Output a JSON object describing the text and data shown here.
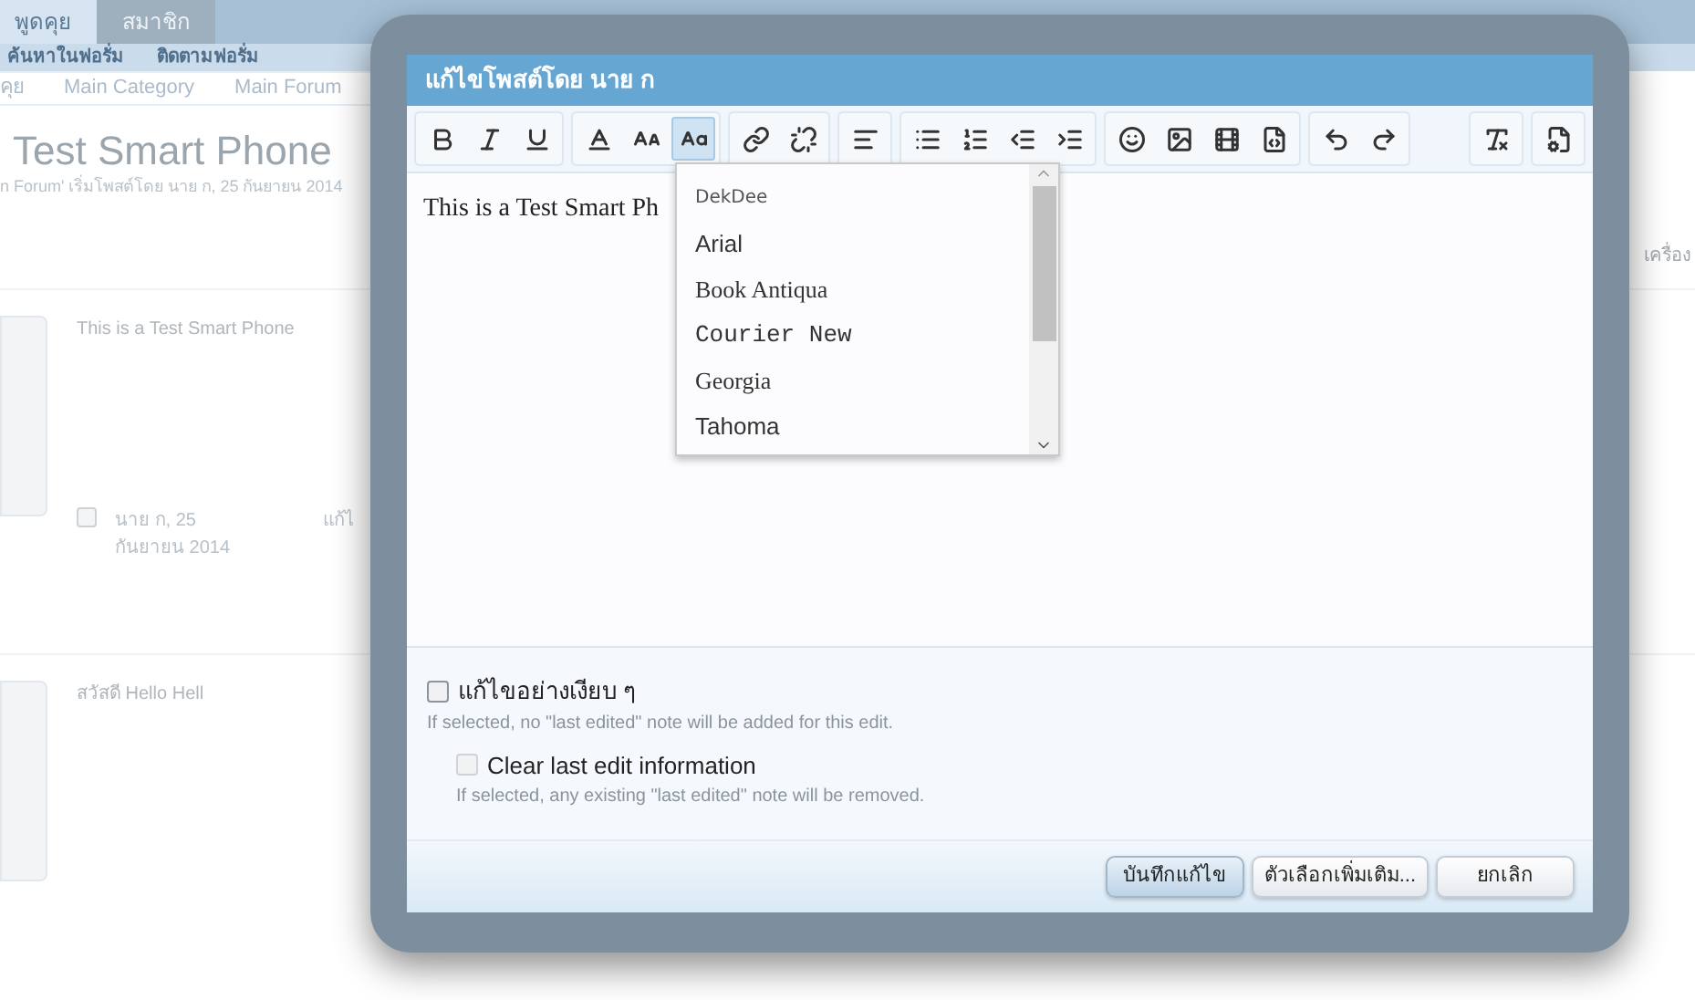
{
  "page": {
    "tabs": [
      {
        "label": "พูดคุย",
        "selected": true
      },
      {
        "label": "สมาชิก",
        "selected": false
      }
    ],
    "subnav": [
      "ค้นหาในฟอรั่ม",
      "ติดตามฟอรั่ม"
    ],
    "breadcrumbs": [
      "คุย",
      "Main Category",
      "Main Forum"
    ],
    "thread_title": "Test Smart Phone",
    "thread_meta": "n Forum' เริ่มโพสต์โดย นาย ก, 25 กันยายน 2014",
    "side_text": "เครื่อง",
    "posts": [
      {
        "message": "This is a Test Smart Phone",
        "author_date": "นาย ก, 25 กันยายน 2014",
        "checked": false,
        "action": "แก้ไ"
      },
      {
        "message": "สวัสดี Hello Hell"
      }
    ]
  },
  "dialog": {
    "title": "แก้ไขโพสต์โดย นาย ก",
    "toolbar": [
      [
        {
          "kind": "bold",
          "selected": false
        },
        {
          "kind": "italic",
          "selected": false
        },
        {
          "kind": "underline",
          "selected": false
        }
      ],
      [
        {
          "kind": "color",
          "selected": false
        },
        {
          "kind": "size",
          "selected": false
        },
        {
          "kind": "font",
          "selected": true
        }
      ],
      [
        {
          "kind": "link",
          "selected": false
        },
        {
          "kind": "unlink",
          "selected": false
        }
      ],
      [
        {
          "kind": "align",
          "selected": false
        }
      ],
      [
        {
          "kind": "bullets",
          "selected": false
        },
        {
          "kind": "numbers",
          "selected": false
        },
        {
          "kind": "outdent",
          "selected": false
        },
        {
          "kind": "indent",
          "selected": false
        }
      ],
      [
        {
          "kind": "smiley",
          "selected": false
        },
        {
          "kind": "image",
          "selected": false
        },
        {
          "kind": "media",
          "selected": false
        },
        {
          "kind": "code",
          "selected": false
        }
      ],
      [
        {
          "kind": "undo",
          "selected": false
        },
        {
          "kind": "redo",
          "selected": false
        }
      ],
      [
        {
          "kind": "clear",
          "selected": false
        }
      ],
      [
        {
          "kind": "source",
          "selected": false
        }
      ]
    ],
    "editor_text": "This is a Test Smart Ph",
    "font_menu": [
      {
        "label": "DekDee",
        "kind": "small"
      },
      {
        "label": "Arial",
        "kind": "sans"
      },
      {
        "label": "Book Antiqua",
        "kind": "serif"
      },
      {
        "label": "Courier New",
        "kind": "mono"
      },
      {
        "label": "Georgia",
        "kind": "serif"
      },
      {
        "label": "Tahoma",
        "kind": "sans"
      }
    ],
    "options": [
      {
        "label": "แก้ไขอย่างเงียบ ๆ",
        "hint": "If selected, no \"last edited\" note will be added for this edit.",
        "checked": false,
        "disabled": false
      },
      {
        "label": "Clear last edit information",
        "hint": "If selected, any existing \"last edited\" note will be removed.",
        "checked": false,
        "disabled": true
      }
    ],
    "buttons": [
      {
        "label": "บันทึกแก้ไข",
        "kind": "primary"
      },
      {
        "label": "ตัวเลือกเพิ่มเติม...",
        "kind": "normal"
      },
      {
        "label": "ยกเลิก",
        "kind": "normal"
      }
    ]
  }
}
